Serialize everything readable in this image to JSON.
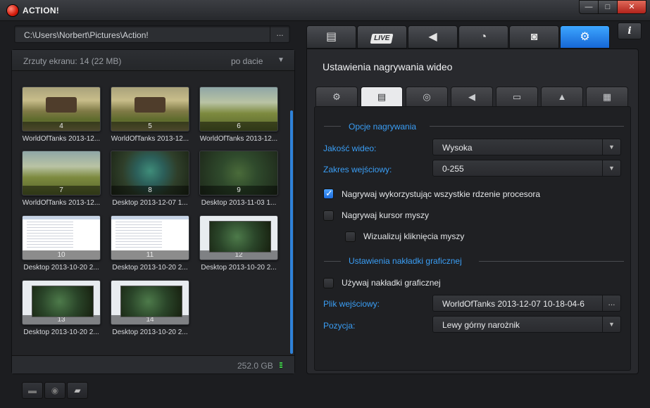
{
  "window": {
    "title": "ACTION!",
    "min_label": "—",
    "max_label": "□",
    "close_label": "✕"
  },
  "path": {
    "value": "C:\\Users\\Norbert\\Pictures\\Action!",
    "browse_label": "..."
  },
  "gallery": {
    "count_label": "Zrzuty ekranu: 14 (22 MB)",
    "sort_label": "po dacie",
    "disk_free": "252.0 GB",
    "thumbnails": [
      {
        "num": "4",
        "caption": "WorldOfTanks 2013-12...",
        "kind": "wot"
      },
      {
        "num": "5",
        "caption": "WorldOfTanks 2013-12...",
        "kind": "wot"
      },
      {
        "num": "6",
        "caption": "WorldOfTanks 2013-12...",
        "kind": "wot2"
      },
      {
        "num": "7",
        "caption": "WorldOfTanks 2013-12...",
        "kind": "wot2"
      },
      {
        "num": "8",
        "caption": "Desktop 2013-12-07 1...",
        "kind": "lol"
      },
      {
        "num": "9",
        "caption": "Desktop 2013-11-03 1...",
        "kind": "lol2"
      },
      {
        "num": "10",
        "caption": "Desktop 2013-10-20 2...",
        "kind": "doc"
      },
      {
        "num": "11",
        "caption": "Desktop 2013-10-20 2...",
        "kind": "doc"
      },
      {
        "num": "12",
        "caption": "Desktop 2013-10-20 2...",
        "kind": "lolwin"
      },
      {
        "num": "13",
        "caption": "Desktop 2013-10-20 2...",
        "kind": "lolwin"
      },
      {
        "num": "14",
        "caption": "Desktop 2013-10-20 2...",
        "kind": "lolwin"
      }
    ]
  },
  "bottom_buttons": {
    "delete_icon": "minus-icon",
    "view_icon": "eye-icon",
    "open_folder_icon": "folder-icon"
  },
  "main_tabs": [
    {
      "name": "video",
      "icon": "film-icon"
    },
    {
      "name": "live",
      "label": "LIVE"
    },
    {
      "name": "audio",
      "icon": "speaker-icon"
    },
    {
      "name": "benchmark",
      "icon": "stopwatch-icon"
    },
    {
      "name": "screenshots",
      "icon": "camera-icon"
    },
    {
      "name": "settings",
      "icon": "gear-icon",
      "active": true
    }
  ],
  "info_label": "i",
  "settings": {
    "title": "Ustawienia nagrywania wideo",
    "subtabs": [
      {
        "name": "general",
        "icon": "gear-icon"
      },
      {
        "name": "video",
        "icon": "film-icon",
        "active": true
      },
      {
        "name": "webcam",
        "icon": "webcam-icon"
      },
      {
        "name": "audio",
        "icon": "speaker-icon"
      },
      {
        "name": "display",
        "icon": "monitor-icon"
      },
      {
        "name": "upload",
        "icon": "upload-icon"
      },
      {
        "name": "hotkeys",
        "icon": "keyboard-icon"
      }
    ],
    "recording_section": "Opcje nagrywania",
    "quality_label": "Jakość wideo:",
    "quality_value": "Wysoka",
    "range_label": "Zakres wejściowy:",
    "range_value": "0-255",
    "use_all_cores_label": "Nagrywaj wykorzystując wszystkie rdzenie procesora",
    "use_all_cores": true,
    "record_cursor_label": "Nagrywaj kursor myszy",
    "record_cursor": false,
    "visualize_clicks_label": "Wizualizuj kliknięcia myszy",
    "visualize_clicks": false,
    "overlay_section": "Ustawienia nakładki graficznej",
    "use_overlay_label": "Używaj nakładki graficznej",
    "use_overlay": false,
    "input_file_label": "Plik wejściowy:",
    "input_file_value": "WorldOfTanks 2013-12-07 10-18-04-6",
    "input_file_browse": "...",
    "position_label": "Pozycja:",
    "position_value": "Lewy górny narożnik"
  },
  "colors": {
    "accent": "#2f82d9",
    "label_blue": "#3a9ef5",
    "close_red": "#c8352a"
  }
}
